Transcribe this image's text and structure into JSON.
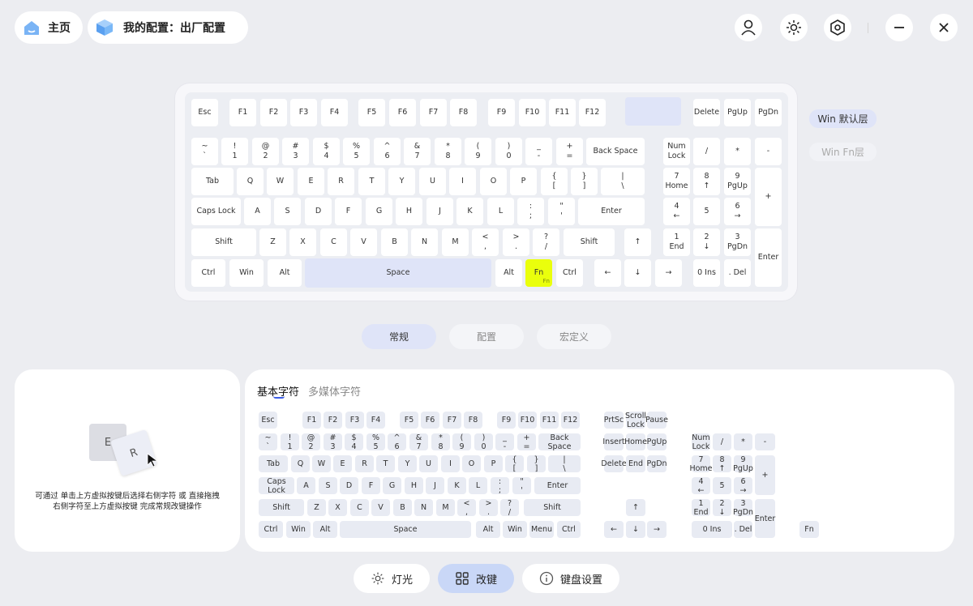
{
  "header": {
    "home_label": "主页",
    "config_label": "我的配置：出厂配置"
  },
  "top_keys": [
    [
      "k-esc",
      "Esc",
      ""
    ],
    [
      "k-f1",
      "F1",
      ""
    ],
    [
      "k-f2",
      "F2",
      ""
    ],
    [
      "k-f3",
      "F3",
      ""
    ],
    [
      "k-f4",
      "F4",
      ""
    ],
    [
      "k-f5",
      "F5",
      ""
    ],
    [
      "k-f6",
      "F6",
      ""
    ],
    [
      "k-f7",
      "F7",
      ""
    ],
    [
      "k-f8",
      "F8",
      ""
    ],
    [
      "k-f9",
      "F9",
      ""
    ],
    [
      "k-f10",
      "F10",
      ""
    ],
    [
      "k-f11",
      "F11",
      ""
    ],
    [
      "k-f12",
      "F12",
      ""
    ],
    [
      "k-blank",
      "",
      "hl"
    ],
    [
      "k-delete",
      "Delete",
      ""
    ],
    [
      "k-pgup",
      "PgUp",
      ""
    ],
    [
      "k-pgdn",
      "PgDn",
      ""
    ],
    [
      "k-tilde",
      "~\n`",
      ""
    ],
    [
      "k-1",
      "!\n1",
      ""
    ],
    [
      "k-2",
      "@\n2",
      ""
    ],
    [
      "k-3",
      "#\n3",
      ""
    ],
    [
      "k-4",
      "$\n4",
      ""
    ],
    [
      "k-5",
      "%\n5",
      ""
    ],
    [
      "k-6",
      "^\n6",
      ""
    ],
    [
      "k-7",
      "&\n7",
      ""
    ],
    [
      "k-8",
      "*\n8",
      ""
    ],
    [
      "k-9",
      "(\n9",
      ""
    ],
    [
      "k-0",
      ")\n0",
      ""
    ],
    [
      "k-minus",
      "_\n-",
      ""
    ],
    [
      "k-equal",
      "+\n=",
      ""
    ],
    [
      "k-backspace",
      "Back Space",
      ""
    ],
    [
      "k-numlock",
      "Num\nLock",
      ""
    ],
    [
      "k-np-slash",
      "/",
      ""
    ],
    [
      "k-np-star",
      "*",
      ""
    ],
    [
      "k-np-minus",
      "-",
      ""
    ],
    [
      "k-tab",
      "Tab",
      ""
    ],
    [
      "k-q",
      "Q",
      ""
    ],
    [
      "k-w",
      "W",
      ""
    ],
    [
      "k-e",
      "E",
      ""
    ],
    [
      "k-r",
      "R",
      ""
    ],
    [
      "k-t",
      "T",
      ""
    ],
    [
      "k-y",
      "Y",
      ""
    ],
    [
      "k-u",
      "U",
      ""
    ],
    [
      "k-i",
      "I",
      ""
    ],
    [
      "k-o",
      "O",
      ""
    ],
    [
      "k-p",
      "P",
      ""
    ],
    [
      "k-lbracket",
      "{\n[",
      ""
    ],
    [
      "k-rbracket",
      "}\n]",
      ""
    ],
    [
      "k-backslash",
      "|\n\\",
      ""
    ],
    [
      "k-np7",
      "7\nHome",
      ""
    ],
    [
      "k-np8",
      "8\n↑",
      ""
    ],
    [
      "k-np9",
      "9\nPgUp",
      ""
    ],
    [
      "k-np-plus",
      "+",
      ""
    ],
    [
      "k-capslock",
      "Caps Lock",
      ""
    ],
    [
      "k-a",
      "A",
      ""
    ],
    [
      "k-s",
      "S",
      ""
    ],
    [
      "k-d",
      "D",
      ""
    ],
    [
      "k-f",
      "F",
      ""
    ],
    [
      "k-g",
      "G",
      ""
    ],
    [
      "k-h",
      "H",
      ""
    ],
    [
      "k-j",
      "J",
      ""
    ],
    [
      "k-k",
      "K",
      ""
    ],
    [
      "k-l",
      "L",
      ""
    ],
    [
      "k-semicolon",
      ":\n;",
      ""
    ],
    [
      "k-quote",
      "\"\n'",
      ""
    ],
    [
      "k-enter",
      "Enter",
      ""
    ],
    [
      "k-np4",
      "4\n←",
      ""
    ],
    [
      "k-np5",
      "5",
      ""
    ],
    [
      "k-np6",
      "6\n→",
      ""
    ],
    [
      "k-lshift",
      "Shift",
      ""
    ],
    [
      "k-z",
      "Z",
      ""
    ],
    [
      "k-x",
      "X",
      ""
    ],
    [
      "k-c",
      "C",
      ""
    ],
    [
      "k-v",
      "V",
      ""
    ],
    [
      "k-b",
      "B",
      ""
    ],
    [
      "k-n",
      "N",
      ""
    ],
    [
      "k-m",
      "M",
      ""
    ],
    [
      "k-comma",
      "<\n,",
      ""
    ],
    [
      "k-period",
      ">\n.",
      ""
    ],
    [
      "k-slash",
      "?\n/",
      ""
    ],
    [
      "k-rshift",
      "Shift",
      ""
    ],
    [
      "k-up",
      "↑",
      ""
    ],
    [
      "k-np1",
      "1\nEnd",
      ""
    ],
    [
      "k-np2",
      "2\n↓",
      ""
    ],
    [
      "k-np3",
      "3\nPgDn",
      ""
    ],
    [
      "k-np-enter",
      "Enter",
      ""
    ],
    [
      "k-lctrl",
      "Ctrl",
      ""
    ],
    [
      "k-lwin",
      "Win",
      ""
    ],
    [
      "k-lalt",
      "Alt",
      ""
    ],
    [
      "k-space",
      "Space",
      "hl"
    ],
    [
      "k-ralt",
      "Alt",
      ""
    ],
    [
      "k-fn",
      "Fn",
      "fn"
    ],
    [
      "k-rctrl",
      "Ctrl",
      ""
    ],
    [
      "k-left",
      "←",
      ""
    ],
    [
      "k-down",
      "↓",
      ""
    ],
    [
      "k-right",
      "→",
      ""
    ],
    [
      "k-np0",
      "0 Ins",
      ""
    ],
    [
      "k-np-del",
      ". Del",
      ""
    ]
  ],
  "fn_sub": "Fn",
  "layers": {
    "win_default": "Win 默认层",
    "win_fn": "Win Fn层"
  },
  "tabs": {
    "normal": "常规",
    "config": "配置",
    "macro": "宏定义"
  },
  "hint": {
    "key1": "E",
    "key2": "R",
    "text": "可通过 单击上方虚拟按键后选择右侧字符 或 直接拖拽\n右侧字符至上方虚拟按键 完成常规改键操作"
  },
  "char_tabs": {
    "basic": "基本字符",
    "media": "多媒体字符"
  },
  "bottom_keys": [
    [
      "b-esc",
      "Esc"
    ],
    [
      "b-f1",
      "F1"
    ],
    [
      "b-f2",
      "F2"
    ],
    [
      "b-f3",
      "F3"
    ],
    [
      "b-f4",
      "F4"
    ],
    [
      "b-f5",
      "F5"
    ],
    [
      "b-f6",
      "F6"
    ],
    [
      "b-f7",
      "F7"
    ],
    [
      "b-f8",
      "F8"
    ],
    [
      "b-f9",
      "F9"
    ],
    [
      "b-f10",
      "F10"
    ],
    [
      "b-f11",
      "F11"
    ],
    [
      "b-f12",
      "F12"
    ],
    [
      "b-prtsc",
      "PrtSc"
    ],
    [
      "b-scrolllock",
      "Scroll\nLock"
    ],
    [
      "b-pause",
      "Pause"
    ],
    [
      "b-tilde",
      "~\n`"
    ],
    [
      "b-1",
      "!\n1"
    ],
    [
      "b-2",
      "@\n2"
    ],
    [
      "b-3",
      "#\n3"
    ],
    [
      "b-4",
      "$\n4"
    ],
    [
      "b-5",
      "%\n5"
    ],
    [
      "b-6",
      "^\n6"
    ],
    [
      "b-7",
      "&\n7"
    ],
    [
      "b-8",
      "*\n8"
    ],
    [
      "b-9",
      "(\n9"
    ],
    [
      "b-0",
      ")\n0"
    ],
    [
      "b-minus",
      "_\n-"
    ],
    [
      "b-equal",
      "+\n="
    ],
    [
      "b-backspace",
      "Back Space"
    ],
    [
      "b-insert",
      "Insert"
    ],
    [
      "b-home",
      "Home"
    ],
    [
      "b-pgup",
      "PgUp"
    ],
    [
      "b-numlock",
      "Num\nLock"
    ],
    [
      "b-np-slash",
      "/"
    ],
    [
      "b-np-star",
      "*"
    ],
    [
      "b-np-minus",
      "-"
    ],
    [
      "b-tab",
      "Tab"
    ],
    [
      "b-q",
      "Q"
    ],
    [
      "b-w",
      "W"
    ],
    [
      "b-e",
      "E"
    ],
    [
      "b-r",
      "R"
    ],
    [
      "b-t",
      "T"
    ],
    [
      "b-y",
      "Y"
    ],
    [
      "b-u",
      "U"
    ],
    [
      "b-i",
      "I"
    ],
    [
      "b-o",
      "O"
    ],
    [
      "b-p",
      "P"
    ],
    [
      "b-lbracket",
      "{\n["
    ],
    [
      "b-rbracket",
      "}\n]"
    ],
    [
      "b-backslash",
      "|\n\\"
    ],
    [
      "b-delete",
      "Delete"
    ],
    [
      "b-end",
      "End"
    ],
    [
      "b-pgdn",
      "PgDn"
    ],
    [
      "b-np7",
      "7\nHome"
    ],
    [
      "b-np8",
      "8\n↑"
    ],
    [
      "b-np9",
      "9\nPgUp"
    ],
    [
      "b-np-plus",
      "+"
    ],
    [
      "b-capslock",
      "Caps Lock"
    ],
    [
      "b-a",
      "A"
    ],
    [
      "b-s",
      "S"
    ],
    [
      "b-d",
      "D"
    ],
    [
      "b-f",
      "F"
    ],
    [
      "b-g",
      "G"
    ],
    [
      "b-h",
      "H"
    ],
    [
      "b-j",
      "J"
    ],
    [
      "b-k",
      "K"
    ],
    [
      "b-l",
      "L"
    ],
    [
      "b-semicolon",
      ":\n;"
    ],
    [
      "b-quote",
      "\"\n'"
    ],
    [
      "b-enter",
      "Enter"
    ],
    [
      "b-np4",
      "4\n←"
    ],
    [
      "b-np5",
      "5"
    ],
    [
      "b-np6",
      "6\n→"
    ],
    [
      "b-lshift",
      "Shift"
    ],
    [
      "b-z",
      "Z"
    ],
    [
      "b-x",
      "X"
    ],
    [
      "b-c",
      "C"
    ],
    [
      "b-v",
      "V"
    ],
    [
      "b-b",
      "B"
    ],
    [
      "b-n",
      "N"
    ],
    [
      "b-m",
      "M"
    ],
    [
      "b-comma",
      "<\n,"
    ],
    [
      "b-period",
      ">\n."
    ],
    [
      "b-slash",
      "?\n/"
    ],
    [
      "b-rshift",
      "Shift"
    ],
    [
      "b-up",
      "↑"
    ],
    [
      "b-np1",
      "1\nEnd"
    ],
    [
      "b-np2",
      "2\n↓"
    ],
    [
      "b-np3",
      "3\nPgDn"
    ],
    [
      "b-np-enter",
      "Enter"
    ],
    [
      "b-lctrl",
      "Ctrl"
    ],
    [
      "b-lwin",
      "Win"
    ],
    [
      "b-lalt",
      "Alt"
    ],
    [
      "b-space",
      "Space"
    ],
    [
      "b-ralt",
      "Alt"
    ],
    [
      "b-rwin",
      "Win"
    ],
    [
      "b-menu",
      "Menu"
    ],
    [
      "b-rctrl",
      "Ctrl"
    ],
    [
      "b-left",
      "←"
    ],
    [
      "b-down",
      "↓"
    ],
    [
      "b-right",
      "→"
    ],
    [
      "b-np0",
      "0 Ins"
    ],
    [
      "b-np-del",
      ". Del"
    ],
    [
      "b-fn",
      "Fn"
    ]
  ],
  "footer": {
    "light_label": "灯光",
    "remap_label": "改键",
    "settings_label": "键盘设置"
  },
  "colors": {
    "accent": "#dfe4f8",
    "highlight": "#eaff0c",
    "brand_blue": "#5aa0f0"
  }
}
